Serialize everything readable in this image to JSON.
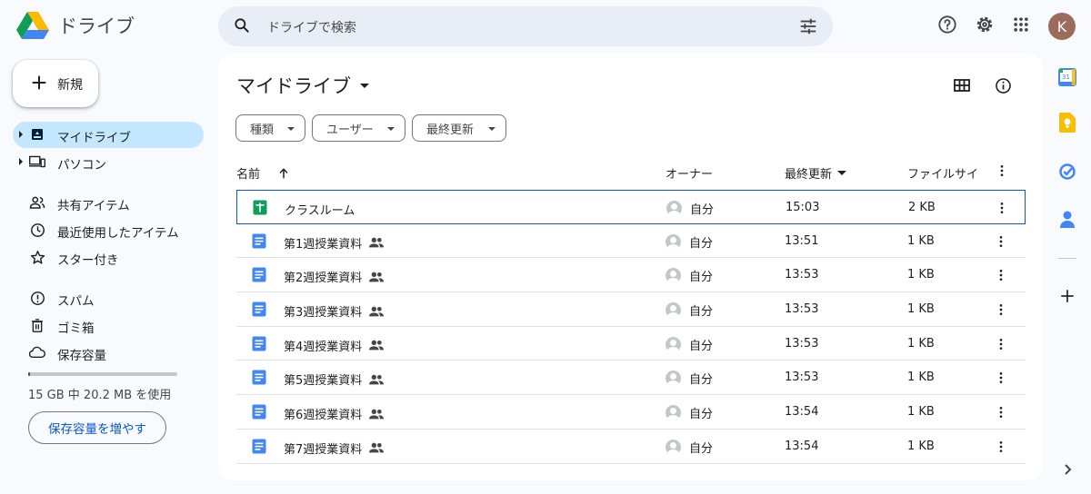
{
  "app": {
    "title": "ドライブ"
  },
  "search": {
    "placeholder": "ドライブで検索"
  },
  "header": {
    "avatar_letter": "K"
  },
  "nav": {
    "new_label": "新規",
    "items": [
      {
        "label": "マイドライブ",
        "icon": "my-drive-icon"
      },
      {
        "label": "パソコン",
        "icon": "computer-icon"
      },
      {
        "label": "共有アイテム",
        "icon": "shared-icon"
      },
      {
        "label": "最近使用したアイテム",
        "icon": "clock-icon"
      },
      {
        "label": "スター付き",
        "icon": "star-icon"
      },
      {
        "label": "スパム",
        "icon": "spam-icon"
      },
      {
        "label": "ゴミ箱",
        "icon": "trash-icon"
      },
      {
        "label": "保存容量",
        "icon": "cloud-icon"
      }
    ],
    "storage_text": "15 GB 中 20.2 MB を使用",
    "storage_used_fraction": 0.0013,
    "storage_button": "保存容量を増やす"
  },
  "main": {
    "title": "マイドライブ",
    "filters": [
      "種類",
      "ユーザー",
      "最終更新"
    ],
    "columns": {
      "name": "名前",
      "owner": "オーナー",
      "modified": "最終更新",
      "size": "ファイルサイ"
    },
    "files": [
      {
        "name": "クラスルーム",
        "type": "sheets",
        "shared": false,
        "owner": "自分",
        "modified": "15:03",
        "size": "2 KB"
      },
      {
        "name": "第1週授業資料",
        "type": "docs",
        "shared": true,
        "owner": "自分",
        "modified": "13:51",
        "size": "1 KB"
      },
      {
        "name": "第2週授業資料",
        "type": "docs",
        "shared": true,
        "owner": "自分",
        "modified": "13:53",
        "size": "1 KB"
      },
      {
        "name": "第3週授業資料",
        "type": "docs",
        "shared": true,
        "owner": "自分",
        "modified": "13:53",
        "size": "1 KB"
      },
      {
        "name": "第4週授業資料",
        "type": "docs",
        "shared": true,
        "owner": "自分",
        "modified": "13:53",
        "size": "1 KB"
      },
      {
        "name": "第5週授業資料",
        "type": "docs",
        "shared": true,
        "owner": "自分",
        "modified": "13:53",
        "size": "1 KB"
      },
      {
        "name": "第6週授業資料",
        "type": "docs",
        "shared": true,
        "owner": "自分",
        "modified": "13:54",
        "size": "1 KB"
      },
      {
        "name": "第7週授業資料",
        "type": "docs",
        "shared": true,
        "owner": "自分",
        "modified": "13:54",
        "size": "1 KB"
      }
    ]
  },
  "colors": {
    "accent": "#0b57d0",
    "active_nav": "#c2e7ff",
    "docs": "#4285f4",
    "sheets": "#0f9d58"
  }
}
